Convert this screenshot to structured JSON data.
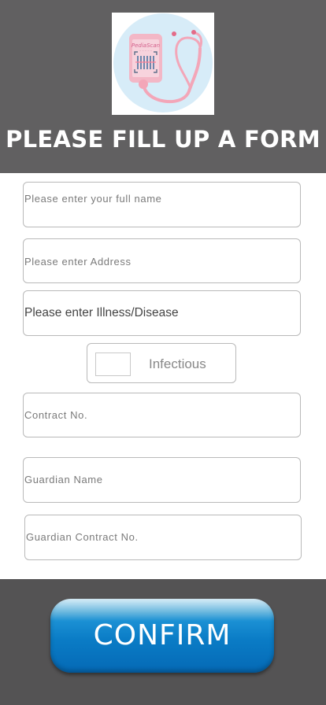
{
  "header": {
    "logo": {
      "text": "PediaScan",
      "icon": "stethoscope-phone-logo"
    },
    "title": "PLEASE FILL UP A FORM"
  },
  "form": {
    "full_name_placeholder": "Please enter your full name",
    "address_placeholder": "Please enter Address",
    "illness_placeholder": "Please enter Illness/Disease",
    "infectious_label": "Infectious",
    "contact_placeholder": "Contract No.",
    "guardian_name_placeholder": "Guardian Name",
    "guardian_contact_placeholder": "Guardian Contract No."
  },
  "footer": {
    "confirm_label": "CONFIRM"
  },
  "colors": {
    "header_bg": "#616061",
    "footer_bg": "#545354",
    "button_blue": "#0a7cc6"
  }
}
